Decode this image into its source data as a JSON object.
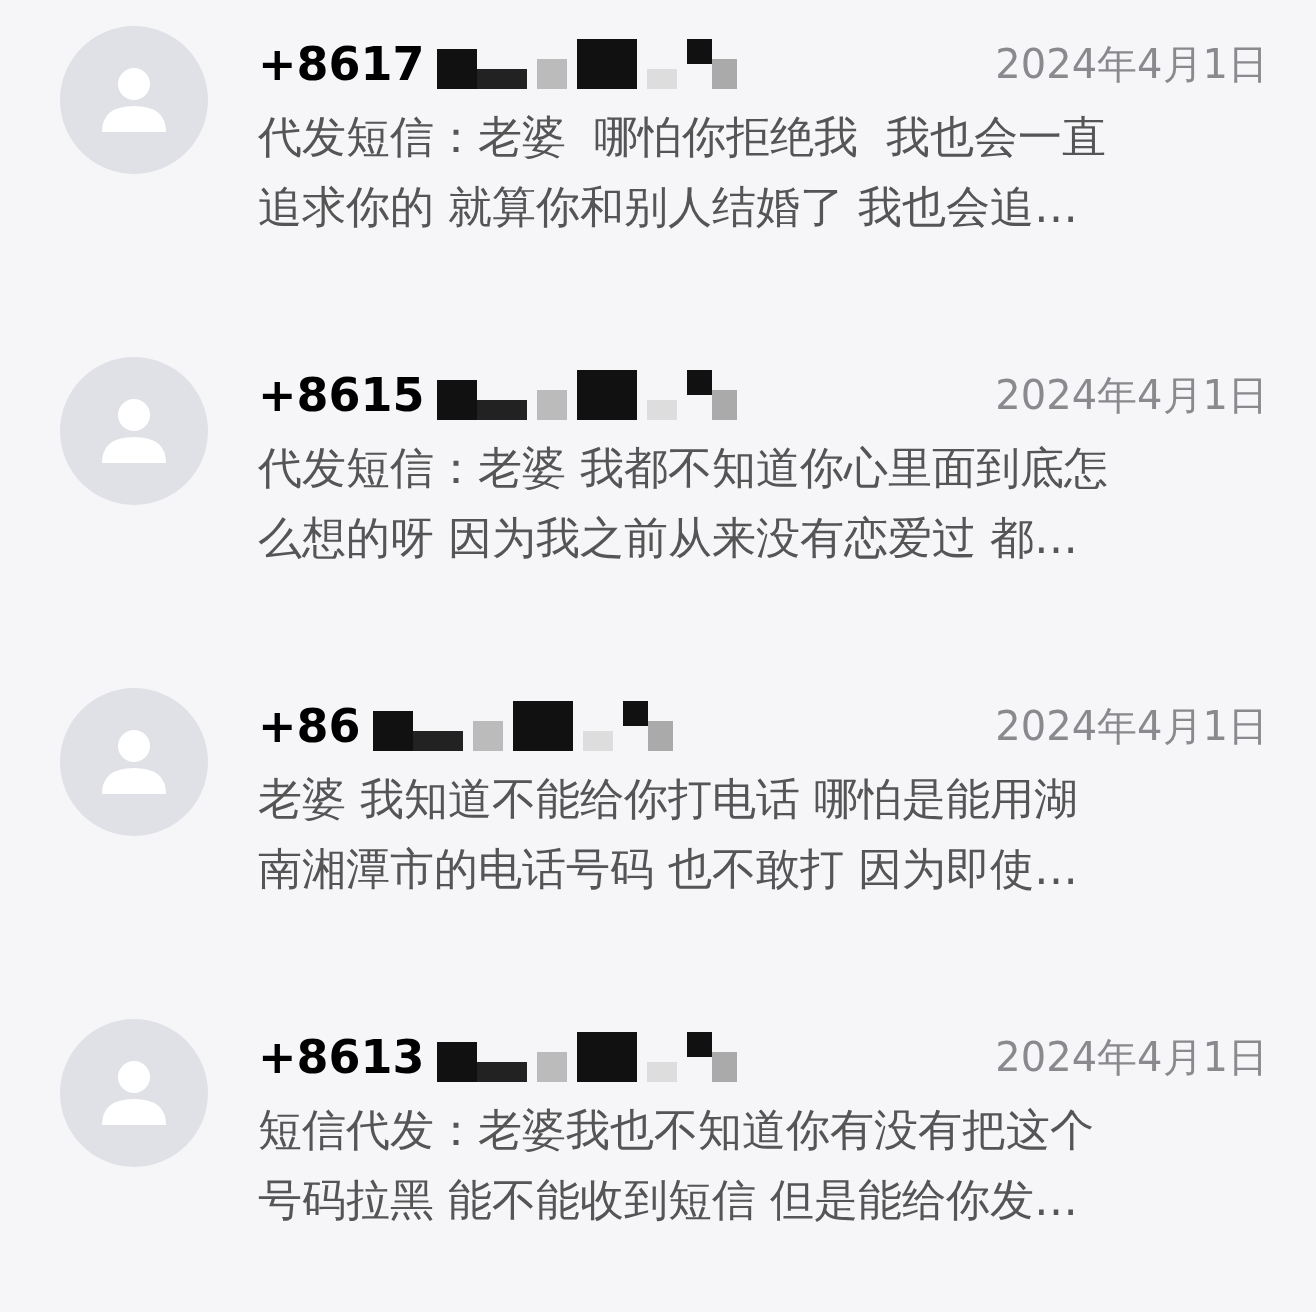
{
  "messages": [
    {
      "sender": "+8617",
      "date": "2024年4月1日",
      "preview_lines": [
        "代发短信：老婆  哪怕你拒绝我  我也会一直",
        "追求你的 就算你和别人结婚了 我也会追…"
      ]
    },
    {
      "sender": "+8615",
      "date": "2024年4月1日",
      "preview_lines": [
        "代发短信：老婆 我都不知道你心里面到底怎",
        "么想的呀 因为我之前从来没有恋爱过 都…"
      ]
    },
    {
      "sender": "+86",
      "date": "2024年4月1日",
      "preview_lines": [
        "老婆 我知道不能给你打电话 哪怕是能用湖",
        "南湘潭市的电话号码 也不敢打 因为即使…"
      ]
    },
    {
      "sender": "+8613",
      "date": "2024年4月1日",
      "preview_lines": [
        "短信代发：老婆我也不知道你有没有把这个",
        "号码拉黑 能不能收到短信 但是能给你发…"
      ]
    }
  ]
}
